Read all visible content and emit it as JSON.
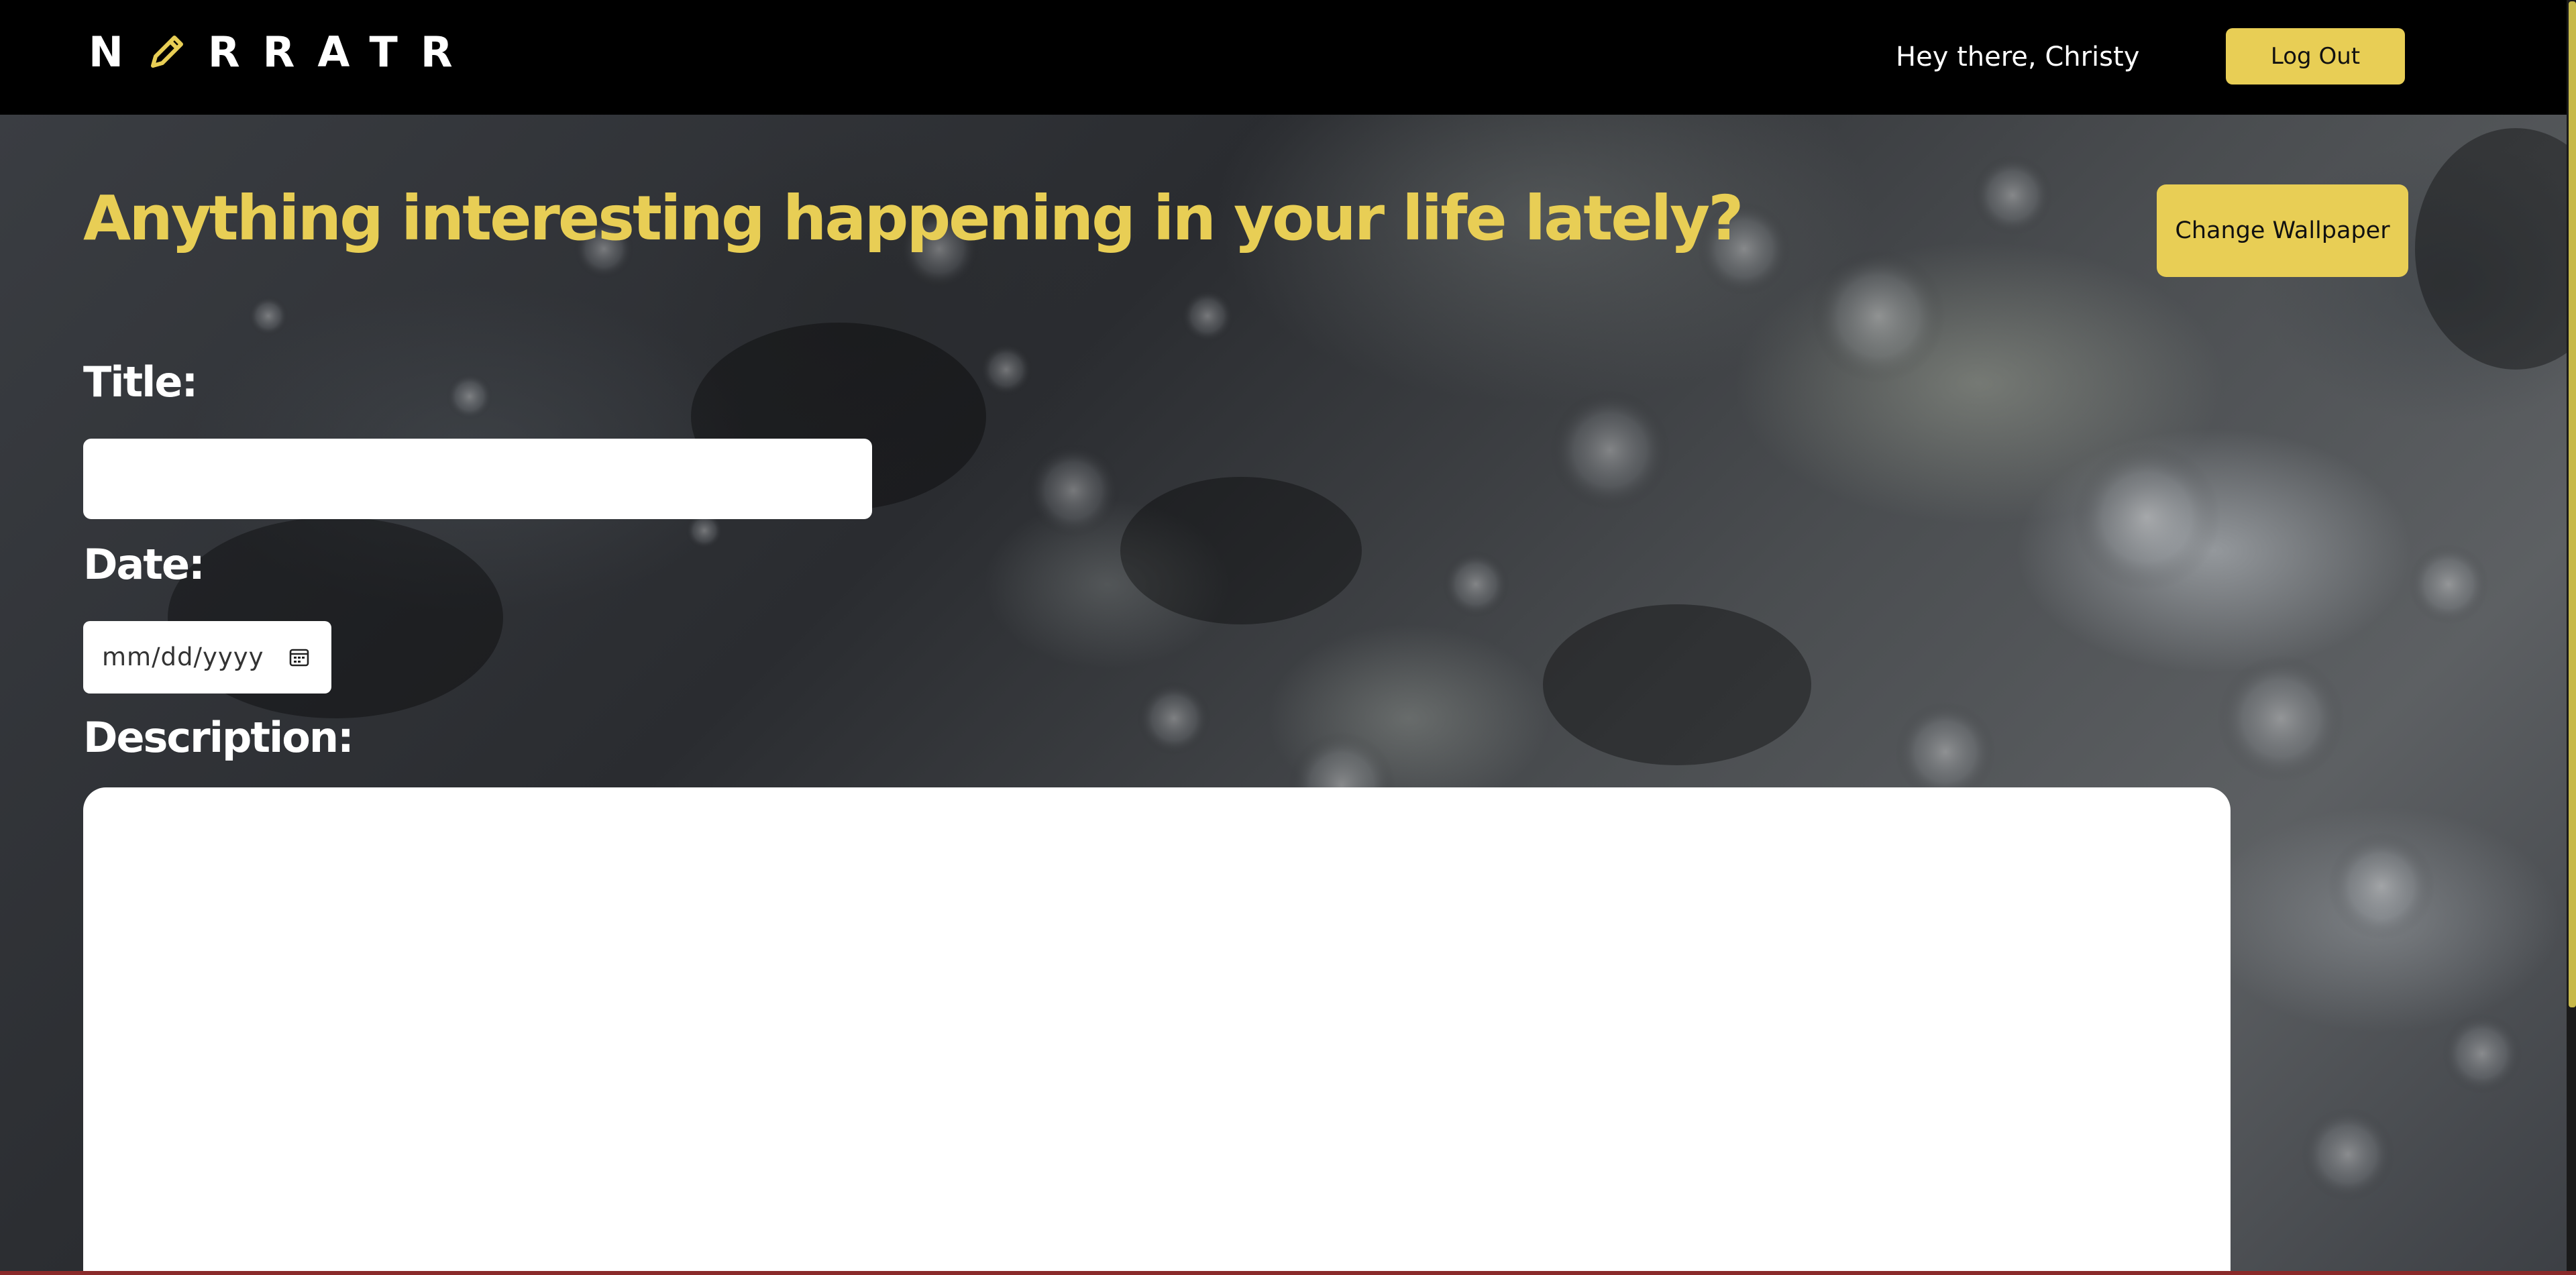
{
  "header": {
    "logo_text": "N RRATR",
    "greeting": "Hey there, Christy",
    "logout_label": "Log Out"
  },
  "main": {
    "headline": "Anything interesting happening in your life lately?",
    "change_wallpaper_label": "Change Wallpaper",
    "title_label": "Title:",
    "title_value": "",
    "date_label": "Date:",
    "date_placeholder": "mm/dd/yyyy",
    "description_label": "Description:",
    "description_value": ""
  },
  "colors": {
    "accent": "#e8ce55",
    "header_bg": "#000000",
    "text_light": "#ffffff"
  },
  "icons": {
    "logo_mark": "pencil-icon",
    "date_picker": "calendar-icon"
  }
}
